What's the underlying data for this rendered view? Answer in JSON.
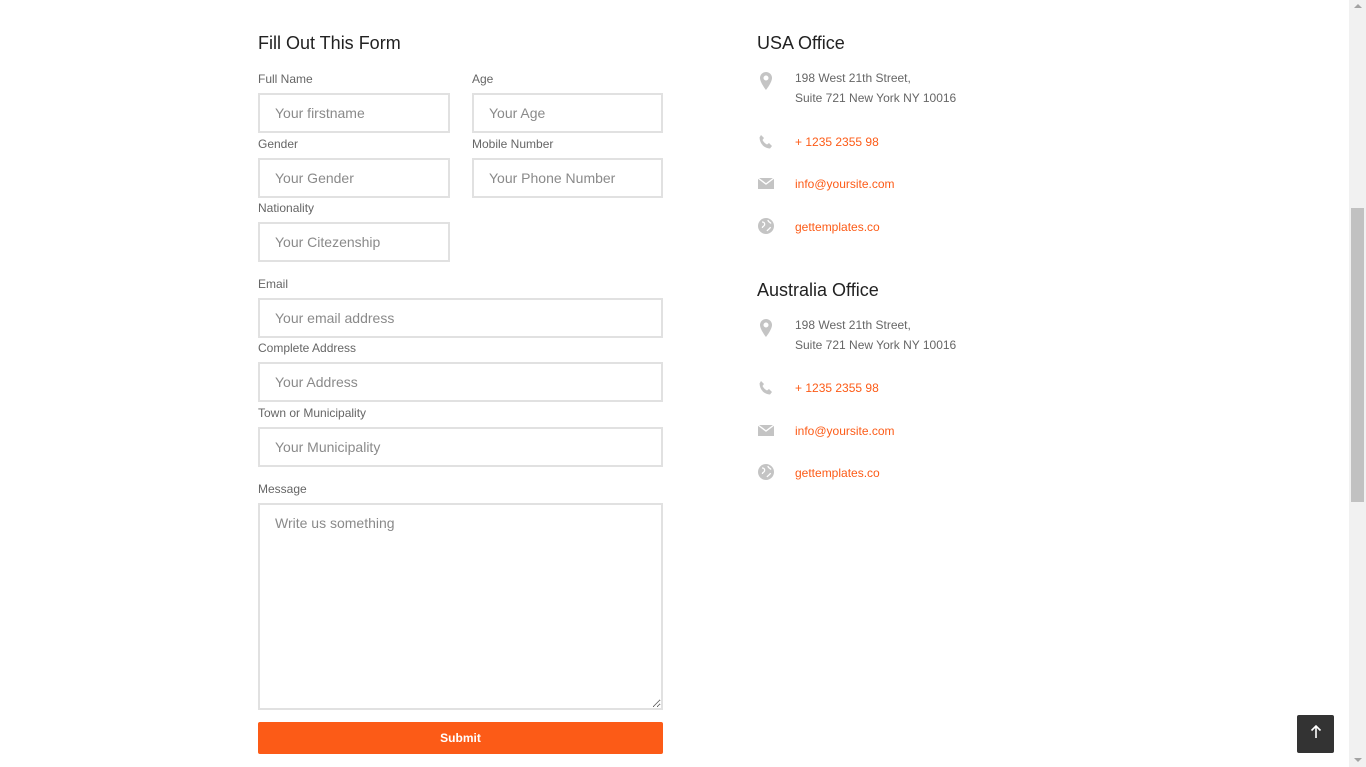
{
  "form": {
    "title": "Fill Out This Form",
    "fields": {
      "full_name": {
        "label": "Full Name",
        "placeholder": "Your firstname"
      },
      "age": {
        "label": "Age",
        "placeholder": "Your Age"
      },
      "gender": {
        "label": "Gender",
        "placeholder": "Your Gender"
      },
      "mobile": {
        "label": "Mobile Number",
        "placeholder": "Your Phone Number"
      },
      "nationality": {
        "label": "Nationality",
        "placeholder": "Your Citezenship"
      },
      "email": {
        "label": "Email",
        "placeholder": "Your email address"
      },
      "address": {
        "label": "Complete Address",
        "placeholder": "Your Address"
      },
      "municipality": {
        "label": "Town or Municipality",
        "placeholder": "Your Municipality"
      },
      "message": {
        "label": "Message",
        "placeholder": "Write us something"
      }
    },
    "submit_label": "Submit"
  },
  "offices": [
    {
      "title": "USA Office",
      "address_line1": "198 West 21th Street,",
      "address_line2": "Suite 721 New York NY 10016",
      "phone": "+ 1235 2355 98",
      "email": "info@yoursite.com",
      "website": "gettemplates.co"
    },
    {
      "title": "Australia Office",
      "address_line1": "198 West 21th Street,",
      "address_line2": "Suite 721 New York NY 10016",
      "phone": "+ 1235 2355 98",
      "email": "info@yoursite.com",
      "website": "gettemplates.co"
    }
  ],
  "icons": {
    "location": "map-pin-icon",
    "phone": "phone-icon",
    "email": "envelope-icon",
    "website": "globe-icon",
    "back_to_top": "arrow-up-icon"
  },
  "colors": {
    "accent": "#fc5b17",
    "icon_gray": "#c4c4c4",
    "to_top_bg": "#333333"
  }
}
